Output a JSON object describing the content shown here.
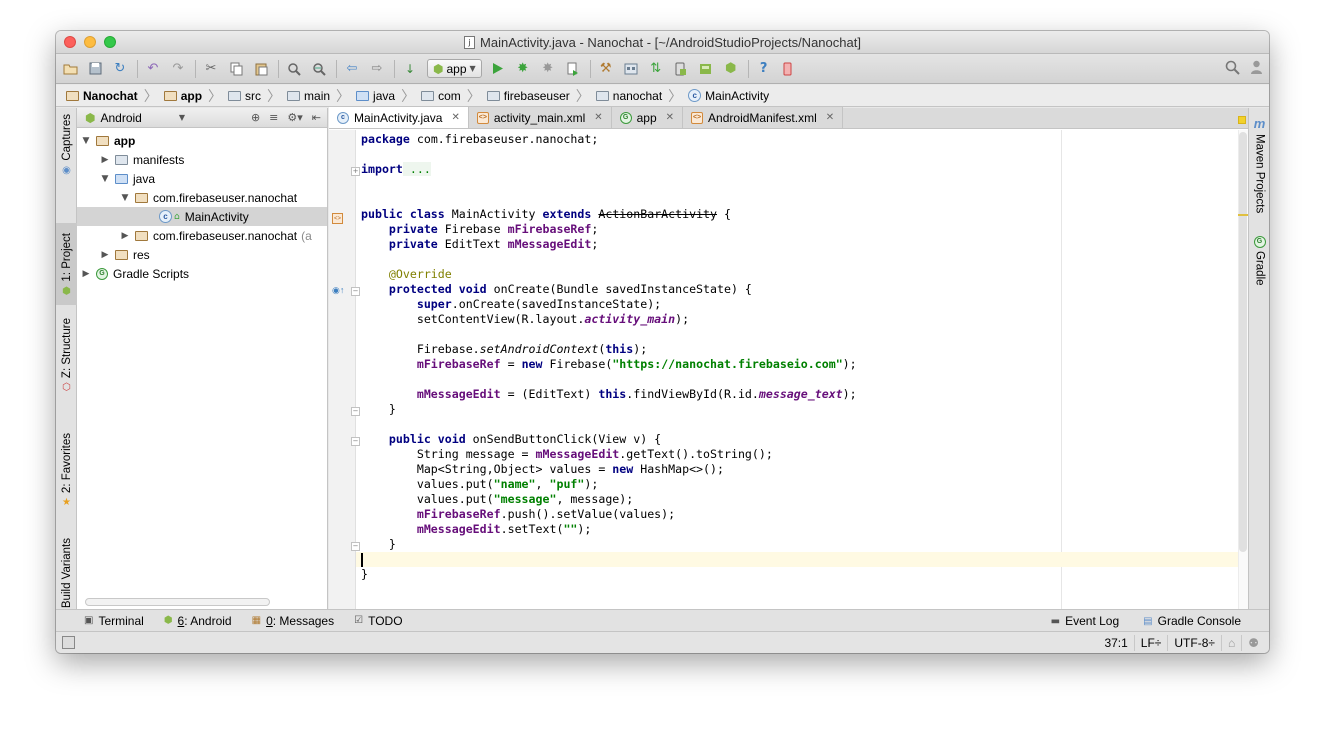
{
  "window": {
    "title": "MainActivity.java - Nanochat - [~/AndroidStudioProjects/Nanochat]"
  },
  "toolbar": {
    "run_config": "app",
    "icons": [
      "open-folder-icon",
      "save-icon",
      "sync-icon",
      "undo-icon",
      "redo-icon",
      "cut-icon",
      "copy-icon",
      "paste-icon",
      "find-icon",
      "replace-icon",
      "back-icon",
      "forward-icon",
      "make-project-icon",
      "run-icon",
      "debug-icon",
      "attach-debugger-icon",
      "run-coverage-icon",
      "project-structure-icon",
      "sdk-manager-icon",
      "sync-gradle-icon",
      "avd-manager-icon",
      "android-device-monitor-icon",
      "android-icon",
      "help-icon",
      "device-icon"
    ]
  },
  "breadcrumbs": [
    "Nanochat",
    "app",
    "src",
    "main",
    "java",
    "com",
    "firebaseuser",
    "nanochat",
    "MainActivity"
  ],
  "left_stripe": {
    "captures": "Captures",
    "project": "1: Project",
    "structure": "Z: Structure",
    "favorites": "2: Favorites",
    "build_variants": "Build Variants"
  },
  "right_stripe": {
    "maven": "Maven Projects",
    "gradle": "Gradle"
  },
  "project_panel": {
    "view": "Android",
    "tree": [
      {
        "label": "app",
        "level": 0,
        "expanded": true,
        "bold": true
      },
      {
        "label": "manifests",
        "level": 1,
        "expanded": false
      },
      {
        "label": "java",
        "level": 1,
        "expanded": true
      },
      {
        "label": "com.firebaseuser.nanochat",
        "level": 2,
        "expanded": true
      },
      {
        "label": "MainActivity",
        "level": 3,
        "selected": true
      },
      {
        "label": "com.firebaseuser.nanochat",
        "suffix": "(a",
        "level": 2,
        "expanded": false
      },
      {
        "label": "res",
        "level": 1,
        "expanded": false
      },
      {
        "label": "Gradle Scripts",
        "level": 0,
        "expanded": false
      }
    ]
  },
  "editor_tabs": [
    {
      "label": "MainActivity.java",
      "type": "java",
      "active": true
    },
    {
      "label": "activity_main.xml",
      "type": "xml",
      "active": false
    },
    {
      "label": "app",
      "type": "gradle",
      "active": false
    },
    {
      "label": "AndroidManifest.xml",
      "type": "xml",
      "active": false
    }
  ],
  "code": {
    "line_package": [
      "package",
      " com.firebaseuser.nanochat;"
    ],
    "line_import": [
      "import",
      " ..."
    ],
    "line_class": [
      "public class",
      " MainActivity ",
      "extends",
      " ",
      "ActionBarActivity",
      " {"
    ],
    "line_field1": [
      "    ",
      "private",
      " Firebase ",
      "mFirebaseRef",
      ";"
    ],
    "line_field2": [
      "    ",
      "private",
      " EditText ",
      "mMessageEdit",
      ";"
    ],
    "line_override": [
      "    ",
      "@Override"
    ],
    "line_oncreate": [
      "    ",
      "protected void",
      " onCreate(Bundle savedInstanceState) {"
    ],
    "line_super": [
      "        ",
      "super",
      ".onCreate(savedInstanceState);"
    ],
    "line_setcontent": [
      "        setContentView(R.layout.",
      "activity_main",
      ");"
    ],
    "line_setctx": [
      "        Firebase.",
      "setAndroidContext",
      "(",
      "this",
      ");"
    ],
    "line_newref": [
      "        ",
      "mFirebaseRef",
      " = ",
      "new",
      " Firebase(",
      "\"https://nanochat.firebaseio.com\"",
      ");"
    ],
    "line_findview": [
      "        ",
      "mMessageEdit",
      " = (EditText) ",
      "this",
      ".findViewById(R.id.",
      "message_text",
      ");"
    ],
    "line_close1": [
      "    }"
    ],
    "line_onsend": [
      "    ",
      "public void",
      " onSendButtonClick(View v) {"
    ],
    "line_message": [
      "        String message = ",
      "mMessageEdit",
      ".getText().toString();"
    ],
    "line_map": [
      "        Map<String,Object> values = ",
      "new",
      " HashMap<>();"
    ],
    "line_putname": [
      "        values.put(",
      "\"name\"",
      ", ",
      "\"puf\"",
      ");"
    ],
    "line_putmsg": [
      "        values.put(",
      "\"message\"",
      ", message);"
    ],
    "line_push": [
      "        ",
      "mFirebaseRef",
      ".push().setValue(values);"
    ],
    "line_settext": [
      "        ",
      "mMessageEdit",
      ".setText(",
      "\"\"",
      ");"
    ],
    "line_close2": [
      "    }"
    ],
    "line_close3": [
      "}"
    ]
  },
  "bottom_tools": {
    "terminal": "Terminal",
    "android_num": "6",
    "android": ": Android",
    "messages_num": "0",
    "messages": ": Messages",
    "todo": "TODO",
    "event_log": "Event Log",
    "gradle_console": "Gradle Console"
  },
  "status": {
    "position": "37:1",
    "line_sep": "LF÷",
    "encoding": "UTF-8÷"
  }
}
